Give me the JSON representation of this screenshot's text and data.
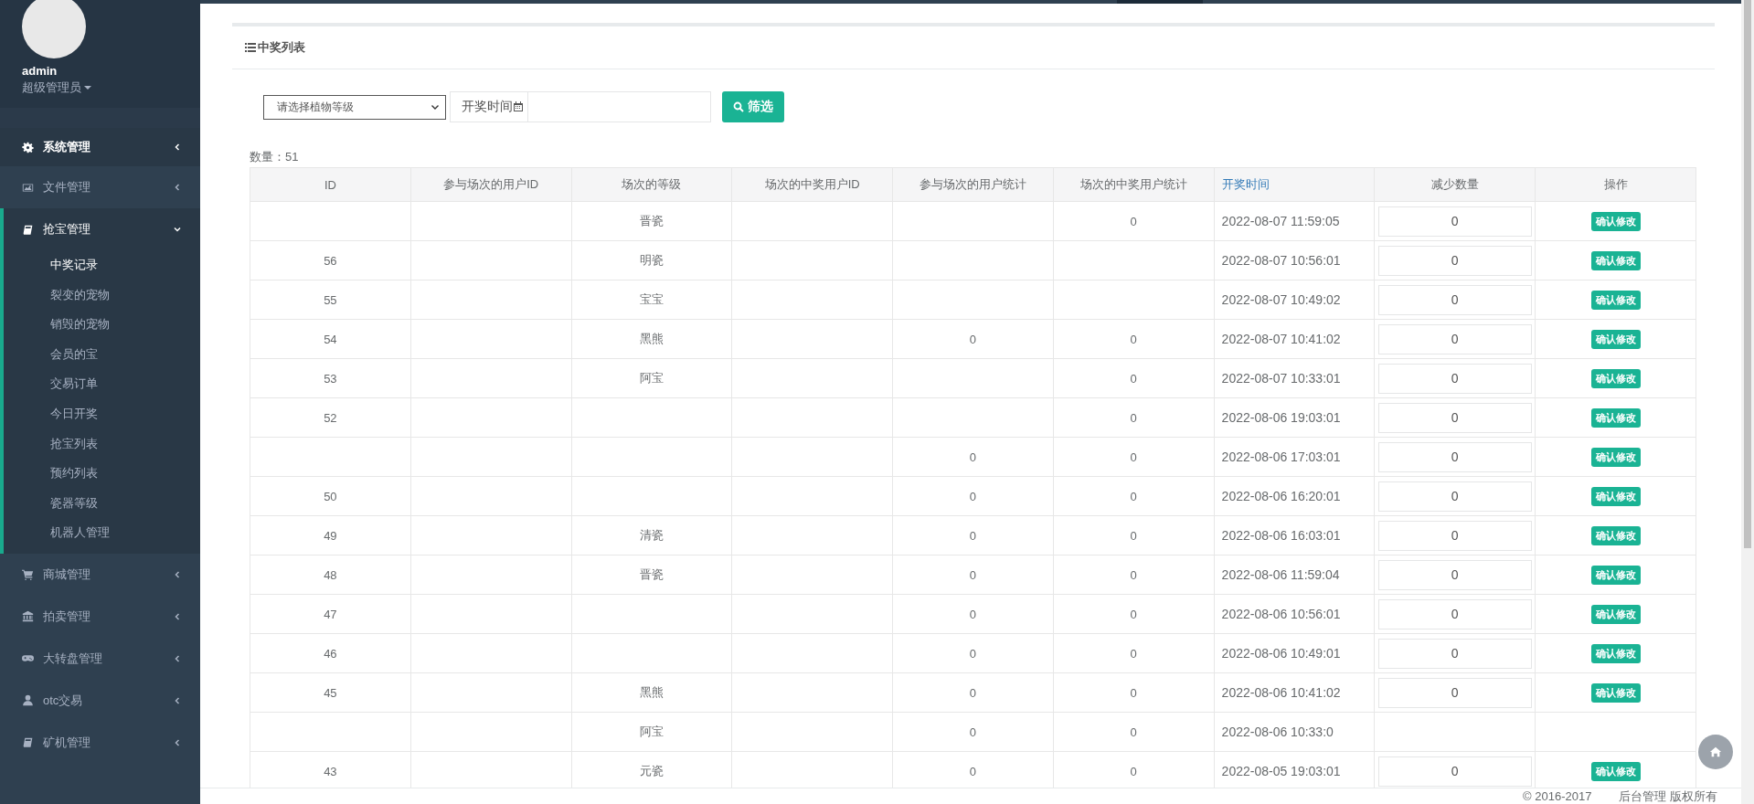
{
  "sidebar": {
    "user": {
      "name": "admin",
      "role": "超级管理员"
    },
    "menu": [
      {
        "label": "系统管理",
        "expanded": false
      },
      {
        "label": "文件管理",
        "expanded": false
      },
      {
        "label": "抢宝管理",
        "expanded": true,
        "children": [
          {
            "label": "中奖记录",
            "selected": true
          },
          {
            "label": "裂变的宠物",
            "selected": false
          },
          {
            "label": "销毁的宠物",
            "selected": false
          },
          {
            "label": "会员的宝",
            "selected": false
          },
          {
            "label": "交易订单",
            "selected": false
          },
          {
            "label": "今日开奖",
            "selected": false
          },
          {
            "label": "抢宝列表",
            "selected": false
          },
          {
            "label": "预约列表",
            "selected": false
          },
          {
            "label": "瓷器等级",
            "selected": false
          },
          {
            "label": "机器人管理",
            "selected": false
          }
        ]
      },
      {
        "label": "商城管理",
        "expanded": false
      },
      {
        "label": "拍卖管理",
        "expanded": false
      },
      {
        "label": "大转盘管理",
        "expanded": false
      },
      {
        "label": "otc交易",
        "expanded": false
      },
      {
        "label": "矿机管理",
        "expanded": false
      }
    ]
  },
  "panel": {
    "title": "中奖列表",
    "filter": {
      "select_placeholder": "请选择植物等级",
      "date_label": "开奖时间",
      "button": "筛选"
    },
    "count": "数量：51",
    "table": {
      "columns": [
        "ID",
        "参与场次的用户ID",
        "场次的等级",
        "场次的中奖用户ID",
        "参与场次的用户统计",
        "场次的中奖用户统计",
        "开奖时间",
        "减少数量",
        "操作"
      ],
      "rows": [
        {
          "level": "晋瓷",
          "win_count": "0",
          "time": "2022-08-07 11:59:05",
          "reduce": "0",
          "action": "确认修改"
        },
        {
          "id": "56",
          "level": "明瓷",
          "time": "2022-08-07 10:56:01",
          "reduce": "0",
          "action": "确认修改"
        },
        {
          "id": "55",
          "level": "宝宝",
          "time": "2022-08-07 10:49:02",
          "reduce": "0",
          "action": "确认修改"
        },
        {
          "id": "54",
          "level": "黑熊",
          "join_count": "0",
          "win_count": "0",
          "time": "2022-08-07 10:41:02",
          "reduce": "0",
          "action": "确认修改"
        },
        {
          "id": "53",
          "level": "阿宝",
          "win_count": "0",
          "time": "2022-08-07 10:33:01",
          "reduce": "0",
          "action": "确认修改"
        },
        {
          "id": "52",
          "win_count": "0",
          "time": "2022-08-06 19:03:01",
          "reduce": "0",
          "action": "确认修改"
        },
        {
          "join_count": "0",
          "win_count": "0",
          "time": "2022-08-06 17:03:01",
          "reduce": "0",
          "action": "确认修改"
        },
        {
          "id": "50",
          "join_count": "0",
          "win_count": "0",
          "time": "2022-08-06 16:20:01",
          "reduce": "0",
          "action": "确认修改"
        },
        {
          "id": "49",
          "level": "清瓷",
          "join_count": "0",
          "win_count": "0",
          "time": "2022-08-06 16:03:01",
          "reduce": "0",
          "action": "确认修改"
        },
        {
          "id": "48",
          "level": "晋瓷",
          "join_count": "0",
          "win_count": "0",
          "time": "2022-08-06 11:59:04",
          "reduce": "0",
          "action": "确认修改"
        },
        {
          "id": "47",
          "join_count": "0",
          "win_count": "0",
          "time": "2022-08-06 10:56:01",
          "reduce": "0",
          "action": "确认修改"
        },
        {
          "id": "46",
          "join_count": "0",
          "win_count": "0",
          "time": "2022-08-06 10:49:01",
          "reduce": "0",
          "action": "确认修改"
        },
        {
          "id": "45",
          "level": "黑熊",
          "join_count": "0",
          "win_count": "0",
          "time": "2022-08-06 10:41:02",
          "reduce": "0",
          "action": "确认修改"
        },
        {
          "level": "阿宝",
          "join_count": "0",
          "win_count": "0",
          "time": "2022-08-06 10:33:0"
        },
        {
          "id": "43",
          "level": "元瓷",
          "join_count": "0",
          "win_count": "0",
          "time": "2022-08-05 19:03:01",
          "reduce": "0",
          "action": "确认修改"
        }
      ]
    }
  },
  "footer": {
    "copyright": "© 2016-2017",
    "owner": "后台管理 版权所有"
  }
}
